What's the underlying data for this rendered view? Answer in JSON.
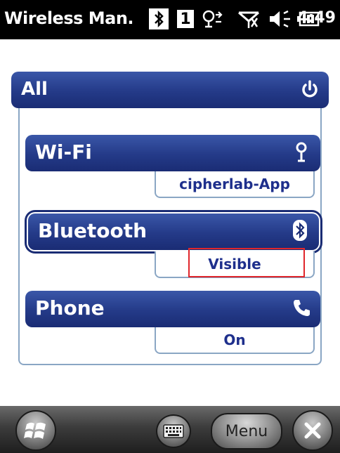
{
  "statusbar": {
    "app_title": "Wireless Man.",
    "sim_number": "1",
    "clock": "4:49",
    "icons": [
      "bluetooth-icon",
      "sim-icon",
      "data-connection-icon",
      "no-signal-icon",
      "volume-icon",
      "battery-icon"
    ]
  },
  "all": {
    "label": "All",
    "icon": "power-icon"
  },
  "cards": [
    {
      "label": "Wi-Fi",
      "status": "cipherlab-App",
      "icon": "wifi-antenna-icon"
    },
    {
      "label": "Bluetooth",
      "status": "Visible",
      "icon": "bluetooth-icon"
    },
    {
      "label": "Phone",
      "status": "On",
      "icon": "phone-icon"
    }
  ],
  "bottombar": {
    "menu_label": "Menu",
    "icons": [
      "start-icon",
      "keyboard-icon",
      "close-icon"
    ]
  },
  "colors": {
    "accent": "#243a88",
    "highlight": "#e0262b",
    "status_text": "#1e2f8c"
  }
}
